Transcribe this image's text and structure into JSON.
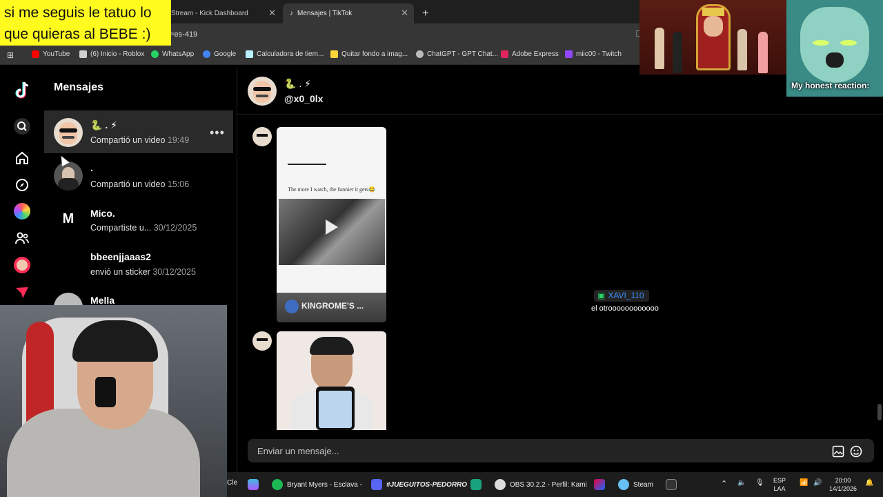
{
  "browser": {
    "tabs": [
      {
        "label": "Stream - Kick Dashboard",
        "active": false
      },
      {
        "label": "Mensajes | TikTok",
        "active": true
      }
    ],
    "url_fragment": "g=es-419",
    "bookmarks": [
      {
        "label": "YouTube",
        "icon": "youtube-icon",
        "color": "#ff0000"
      },
      {
        "label": "(6) Inicio - Roblox",
        "icon": "roblox-icon",
        "color": "#d0d0d0"
      },
      {
        "label": "WhatsApp",
        "icon": "whatsapp-icon",
        "color": "#25d366"
      },
      {
        "label": "Google",
        "icon": "google-icon",
        "color": "#4285f4"
      },
      {
        "label": "Calculadora de tiem...",
        "icon": "calculator-icon",
        "color": "#b8f0ff"
      },
      {
        "label": "Quitar fondo a imag...",
        "icon": "image-icon",
        "color": "#ffd43b"
      },
      {
        "label": "ChatGPT - GPT Chat...",
        "icon": "chatgpt-icon",
        "color": "#bbbbbb"
      },
      {
        "label": "Adobe Express",
        "icon": "adobe-icon",
        "color": "#e0245e"
      },
      {
        "label": "miic00 - Twitch",
        "icon": "twitch-icon",
        "color": "#9146ff"
      }
    ]
  },
  "overlay": {
    "note": "si me seguis le tatuo lo que quieras al BEBE :)",
    "reaction": "My honest reaction:",
    "chat_user": "XAVI_110",
    "chat_message": "el otroooooooooooo"
  },
  "sidebar": {
    "title": "Mensajes",
    "conversations": [
      {
        "name": "🐍 . ⚡",
        "subtitle": "Compartió un video",
        "time": "19:49",
        "selected": true
      },
      {
        "name": ".",
        "subtitle": "Compartió un video",
        "time": "15:06",
        "selected": false
      },
      {
        "name": "Mico.",
        "subtitle": "Compartiste u...",
        "time": "30/12/2025",
        "selected": false
      },
      {
        "name": "bbeenjjaaas2",
        "subtitle": "envió un sticker",
        "time": "30/12/2025",
        "selected": false
      },
      {
        "name": "Mella",
        "subtitle": "",
        "time": "",
        "selected": false
      }
    ]
  },
  "chat": {
    "header_name": "🐍 . ⚡",
    "handle": "@x0_0lx",
    "video1_caption": "The more I watch, the funnier it gets😂",
    "video1_channel": "KINGROME'S ...",
    "input_placeholder": "Enviar un mensaje..."
  },
  "taskbar": {
    "items": [
      {
        "label": "Cle"
      },
      {
        "label": "Bryant Myers - Esclava -",
        "icon": "spotify-icon",
        "color": "#1db954"
      },
      {
        "label": "#JUEGUITOS-PEDORRO",
        "icon": "discord-icon",
        "color": "#5865f2"
      },
      {
        "label": "OBS 30.2.2 - Perfil: Kami",
        "icon": "obs-icon",
        "color": "#dddddd"
      },
      {
        "label": "Steam",
        "icon": "steam-icon",
        "color": "#66c0f4"
      }
    ],
    "lang": "ESP",
    "lang2": "LAA",
    "time": "20:00",
    "date": "14/1/2026"
  },
  "colors": {
    "accent": "#fe2c55",
    "tiktok_cyan": "#25f4ee",
    "note_yellow": "#fffb1f"
  }
}
